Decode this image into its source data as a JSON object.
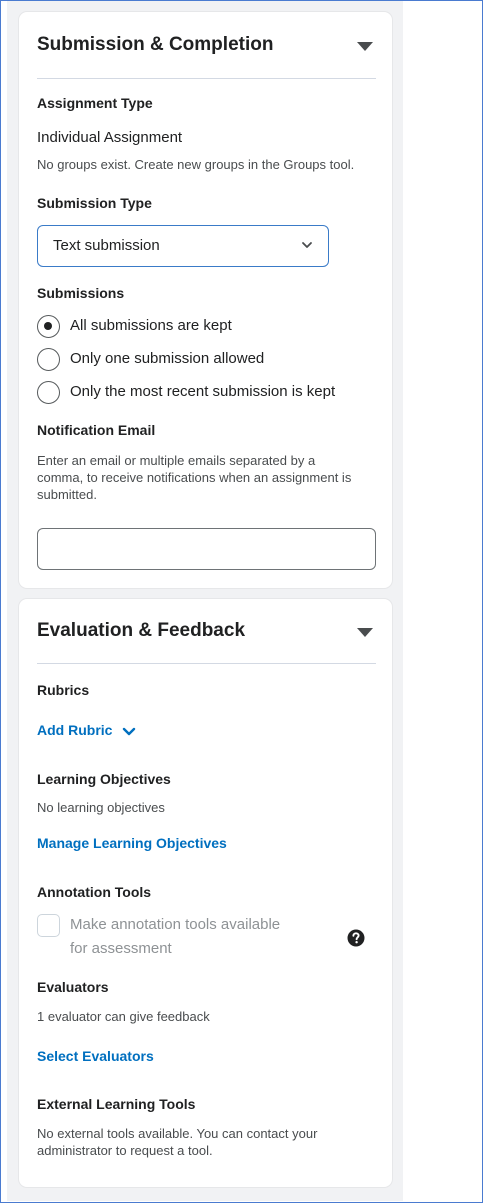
{
  "submission_completion": {
    "title": "Submission & Completion",
    "assignment_type_label": "Assignment Type",
    "assignment_type_value": "Individual Assignment",
    "groups_note": "No groups exist. Create new groups in the Groups tool.",
    "submission_type_label": "Submission Type",
    "submission_type_selected": "Text submission",
    "submissions_label": "Submissions",
    "submission_options": [
      {
        "label": "All submissions are kept",
        "checked": true
      },
      {
        "label": "Only one submission allowed",
        "checked": false
      },
      {
        "label": "Only the most recent submission is kept",
        "checked": false
      }
    ],
    "notification_label": "Notification Email",
    "notification_help_lines": [
      "Enter an email or multiple emails separated by a",
      "comma, to receive notifications when an assignment is",
      "submitted."
    ],
    "notification_value": ""
  },
  "evaluation_feedback": {
    "title": "Evaluation & Feedback",
    "rubrics_label": "Rubrics",
    "add_rubric": "Add Rubric",
    "learning_objectives_label": "Learning Objectives",
    "learning_objectives_note": "No learning objectives",
    "manage_objectives": "Manage Learning Objectives",
    "annotation_label": "Annotation Tools",
    "annotation_checkbox_lines": [
      "Make annotation tools available",
      "for assessment"
    ],
    "evaluators_label": "Evaluators",
    "evaluators_note": "1 evaluator can give feedback",
    "select_evaluators": "Select Evaluators",
    "external_tools_label": "External Learning Tools",
    "external_tools_lines": [
      "No external tools available. You can contact your",
      "administrator to request a tool."
    ]
  },
  "colors": {
    "link": "#006fbf",
    "select_border": "#3a7bc8",
    "panel_bg": "#f1f2f4"
  },
  "icons": {
    "collapse": "caret-down-icon",
    "dropdown": "chevron-down-icon",
    "help": "question-circle-icon"
  }
}
